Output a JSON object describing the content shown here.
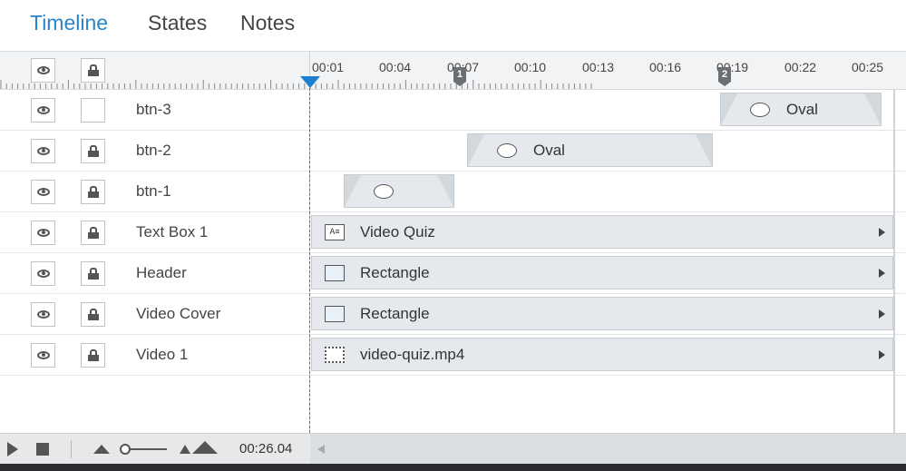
{
  "tabs": [
    "Timeline",
    "States",
    "Notes"
  ],
  "ruler": {
    "ticks": [
      "00:01",
      "00:04",
      "00:07",
      "00:10",
      "00:13",
      "00:16",
      "00:19",
      "00:22",
      "00:25"
    ],
    "markers": [
      "1",
      "2"
    ]
  },
  "rows": [
    {
      "name": "btn-3",
      "locked": false,
      "item": {
        "label": "Oval",
        "icon": "oval-icon"
      }
    },
    {
      "name": "btn-2",
      "locked": true,
      "item": {
        "label": "Oval",
        "icon": "oval-icon"
      }
    },
    {
      "name": "btn-1",
      "locked": true,
      "item": {
        "label": "",
        "icon": "oval-icon"
      }
    },
    {
      "name": "Text Box 1",
      "locked": true,
      "item": {
        "label": "Video Quiz",
        "icon": "text-box-icon"
      }
    },
    {
      "name": "Header",
      "locked": true,
      "item": {
        "label": "Rectangle",
        "icon": "rectangle-icon"
      }
    },
    {
      "name": "Video Cover",
      "locked": true,
      "item": {
        "label": "Rectangle",
        "icon": "rectangle-icon"
      }
    },
    {
      "name": "Video 1",
      "locked": true,
      "item": {
        "label": "video-quiz.mp4",
        "icon": "video-icon"
      }
    }
  ],
  "footer": {
    "duration": "00:26.04"
  },
  "colors": {
    "accent": "#2b84c6",
    "playhead": "#1f7fd0"
  }
}
